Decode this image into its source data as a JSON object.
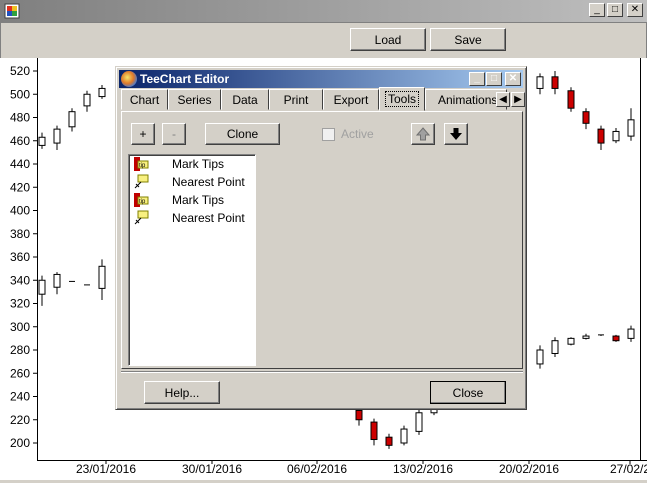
{
  "window": {
    "minimize": "_",
    "maximize": "□",
    "close": "✕"
  },
  "toolbar": {
    "load_label": "Load",
    "save_label": "Save"
  },
  "chart": {
    "y_ticks": [
      "520",
      "500",
      "480",
      "460",
      "440",
      "420",
      "400",
      "380",
      "360",
      "340",
      "320",
      "300",
      "280",
      "260",
      "240",
      "220",
      "200"
    ],
    "x_ticks": [
      "23/01/2016",
      "30/01/2016",
      "06/02/2016",
      "13/02/2016",
      "20/02/2016",
      "27/02/2"
    ],
    "colors": {
      "up": "#ffffff",
      "down": "#cc0000"
    }
  },
  "chart_data": {
    "type": "candlestick",
    "ylim": [
      190,
      525
    ],
    "visible_candles": [
      {
        "open": 456,
        "close": 463,
        "high": 467,
        "low": 453,
        "dir": "up"
      },
      {
        "open": 458,
        "close": 470,
        "high": 473,
        "low": 452,
        "dir": "up"
      },
      {
        "open": 472,
        "close": 485,
        "high": 488,
        "low": 468,
        "dir": "up"
      },
      {
        "open": 490,
        "close": 500,
        "high": 503,
        "low": 485,
        "dir": "up"
      },
      {
        "open": 498,
        "close": 505,
        "high": 508,
        "low": 496,
        "dir": "up"
      },
      {
        "open": 505,
        "close": 515,
        "high": 518,
        "low": 500,
        "dir": "up"
      },
      {
        "open": 515,
        "close": 505,
        "high": 520,
        "low": 500,
        "dir": "down"
      },
      {
        "open": 503,
        "close": 488,
        "high": 506,
        "low": 485,
        "dir": "down"
      },
      {
        "open": 485,
        "close": 475,
        "high": 488,
        "low": 470,
        "dir": "down"
      },
      {
        "open": 470,
        "close": 458,
        "high": 473,
        "low": 452,
        "dir": "down"
      },
      {
        "open": 460,
        "close": 468,
        "high": 471,
        "low": 458,
        "dir": "up"
      },
      {
        "open": 464,
        "close": 478,
        "high": 488,
        "low": 460,
        "dir": "up"
      },
      {
        "open": 328,
        "close": 340,
        "high": 344,
        "low": 318,
        "dir": "up"
      },
      {
        "open": 334,
        "close": 345,
        "high": 347,
        "low": 328,
        "dir": "up"
      },
      {
        "open": 339,
        "close": 339,
        "high": 339,
        "low": 339,
        "dir": "flat"
      },
      {
        "open": 336,
        "close": 336,
        "high": 336,
        "low": 336,
        "dir": "flat"
      },
      {
        "open": 333,
        "close": 352,
        "high": 358,
        "low": 323,
        "dir": "up"
      },
      {
        "open": 228,
        "close": 220,
        "high": 235,
        "low": 215,
        "dir": "down"
      },
      {
        "open": 218,
        "close": 203,
        "high": 221,
        "low": 198,
        "dir": "down"
      },
      {
        "open": 205,
        "close": 198,
        "high": 208,
        "low": 195,
        "dir": "down"
      },
      {
        "open": 200,
        "close": 212,
        "high": 215,
        "low": 198,
        "dir": "up"
      },
      {
        "open": 210,
        "close": 226,
        "high": 230,
        "low": 207,
        "dir": "up"
      },
      {
        "open": 226,
        "close": 230,
        "high": 232,
        "low": 224,
        "dir": "up"
      },
      {
        "open": 268,
        "close": 280,
        "high": 284,
        "low": 264,
        "dir": "up"
      },
      {
        "open": 277,
        "close": 288,
        "high": 291,
        "low": 274,
        "dir": "up"
      },
      {
        "open": 285,
        "close": 290,
        "high": 291,
        "low": 284,
        "dir": "up"
      },
      {
        "open": 290,
        "close": 292,
        "high": 294,
        "low": 289,
        "dir": "up"
      },
      {
        "open": 292,
        "close": 293,
        "high": 293,
        "low": 292,
        "dir": "flat"
      },
      {
        "open": 292,
        "close": 288,
        "high": 293,
        "low": 287,
        "dir": "down"
      },
      {
        "open": 290,
        "close": 298,
        "high": 301,
        "low": 287,
        "dir": "up"
      }
    ]
  },
  "editor": {
    "title": "TeeChart Editor",
    "tabs": [
      "Chart",
      "Series",
      "Data",
      "Print",
      "Export",
      "Tools",
      "Animations"
    ],
    "active_tab": "Tools",
    "add_label": "+",
    "remove_label": "-",
    "clone_label": "Clone",
    "active_label": "Active",
    "tools": [
      {
        "label": "Mark Tips",
        "icon": "mark-tips-icon"
      },
      {
        "label": "Nearest Point",
        "icon": "nearest-point-icon"
      },
      {
        "label": "Mark Tips",
        "icon": "mark-tips-icon"
      },
      {
        "label": "Nearest Point",
        "icon": "nearest-point-icon"
      }
    ],
    "help_label": "Help...",
    "close_label": "Close"
  }
}
